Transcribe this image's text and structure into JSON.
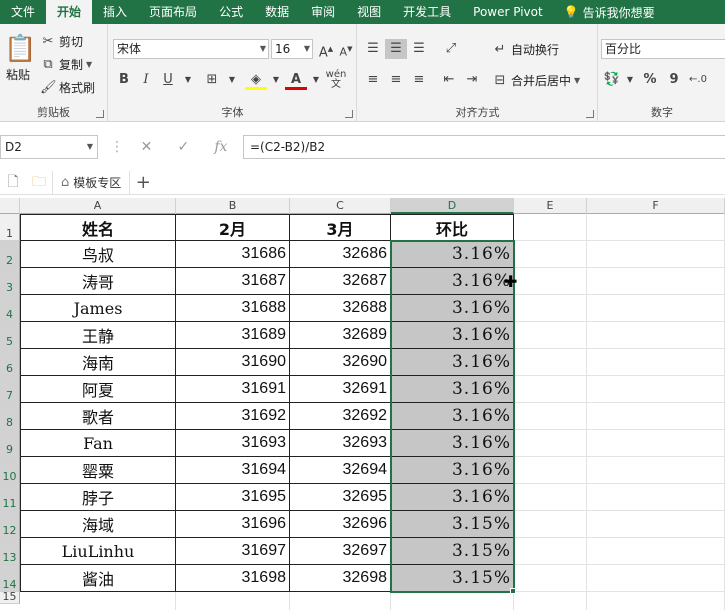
{
  "ribbon_tabs": [
    "文件",
    "开始",
    "插入",
    "页面布局",
    "公式",
    "数据",
    "审阅",
    "视图",
    "开发工具",
    "Power Pivot"
  ],
  "active_tab": "开始",
  "tell_me": "告诉我你想要",
  "clipboard": {
    "paste": "粘贴",
    "cut": "剪切",
    "copy": "复制",
    "format_painter": "格式刷",
    "label": "剪贴板"
  },
  "font": {
    "name": "宋体",
    "size": "16",
    "label": "字体",
    "bold": "B",
    "italic": "I",
    "underline": "U"
  },
  "alignment": {
    "wrap": "自动换行",
    "merge": "合并后居中",
    "label": "对齐方式"
  },
  "number": {
    "format": "百分比",
    "percent": "%",
    "comma": "9",
    "label": "数字"
  },
  "name_box": "D2",
  "formula": "=(C2-B2)/B2",
  "file_tab": "模板专区",
  "columns": [
    "A",
    "B",
    "C",
    "D",
    "E",
    "F"
  ],
  "table": {
    "headers": [
      "姓名",
      "2月",
      "3月",
      "环比"
    ],
    "rows": [
      [
        "鸟叔",
        "31686",
        "32686",
        "3.16%"
      ],
      [
        "涛哥",
        "31687",
        "32687",
        "3.16%"
      ],
      [
        "James",
        "31688",
        "32688",
        "3.16%"
      ],
      [
        "王静",
        "31689",
        "32689",
        "3.16%"
      ],
      [
        "海南",
        "31690",
        "32690",
        "3.16%"
      ],
      [
        "阿夏",
        "31691",
        "32691",
        "3.16%"
      ],
      [
        "歌者",
        "31692",
        "32692",
        "3.16%"
      ],
      [
        "Fan",
        "31693",
        "32693",
        "3.16%"
      ],
      [
        "罂粟",
        "31694",
        "32694",
        "3.16%"
      ],
      [
        "脖子",
        "31695",
        "32695",
        "3.16%"
      ],
      [
        "海域",
        "31696",
        "32696",
        "3.15%"
      ],
      [
        "LiuLinhu",
        "31697",
        "32697",
        "3.15%"
      ],
      [
        "酱油",
        "31698",
        "32698",
        "3.15%"
      ]
    ]
  },
  "row_numbers": [
    "1",
    "2",
    "3",
    "4",
    "5",
    "6",
    "7",
    "8",
    "9",
    "10",
    "11",
    "12",
    "13",
    "14",
    "15"
  ],
  "colors": {
    "accent": "#217346",
    "selection_fill": "#c6c6c6"
  }
}
